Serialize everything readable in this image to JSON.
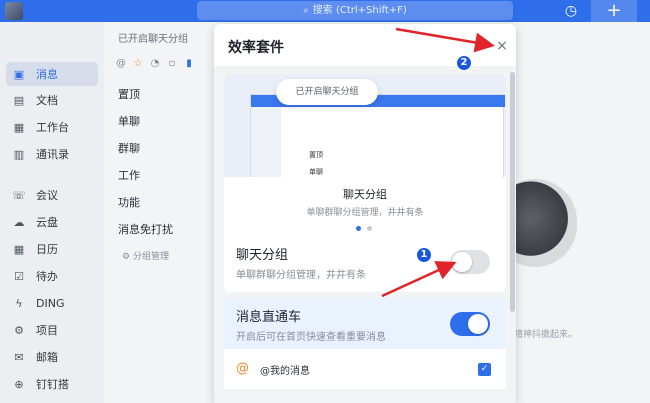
{
  "topbar": {
    "search_placeholder": "搜索 (Ctrl+Shift+F)",
    "search_icon": "search-icon",
    "history_icon": "history-icon",
    "add_label": "+"
  },
  "sidebar": {
    "items": [
      {
        "label": "消息",
        "icon": "message-icon",
        "glyph": "▣",
        "active": true
      },
      {
        "label": "文档",
        "icon": "document-icon",
        "glyph": "▤"
      },
      {
        "label": "工作台",
        "icon": "grid-icon",
        "glyph": "▦"
      },
      {
        "label": "通讯录",
        "icon": "contacts-icon",
        "glyph": "▥"
      },
      {
        "label": "会议",
        "icon": "phone-icon",
        "glyph": "☏"
      },
      {
        "label": "云盘",
        "icon": "cloud-icon",
        "glyph": "☁"
      },
      {
        "label": "日历",
        "icon": "calendar-icon",
        "glyph": "▦"
      },
      {
        "label": "待办",
        "icon": "todo-icon",
        "glyph": "☑"
      },
      {
        "label": "DING",
        "icon": "ding-icon",
        "glyph": "ϟ"
      },
      {
        "label": "项目",
        "icon": "project-icon",
        "glyph": "⚙"
      },
      {
        "label": "邮箱",
        "icon": "mail-icon",
        "glyph": "✉"
      },
      {
        "label": "钉钉搭",
        "icon": "build-icon",
        "glyph": "⊕"
      }
    ]
  },
  "list": {
    "header": "已开启聊天分组",
    "filter_icons": [
      "@",
      "☆",
      "◔",
      "▫",
      "▮"
    ],
    "groups": [
      "置顶",
      "单聊",
      "群聊",
      "工作",
      "功能",
      "消息免打扰"
    ],
    "sub_item": "分组管理"
  },
  "background": {
    "partial_text": "精神抖擞起来。"
  },
  "modal": {
    "title": "效率套件",
    "close_label": "×",
    "preview": {
      "pill_text": "已开启聊天分组",
      "mini_labels": [
        "置顶",
        "单聊"
      ],
      "caption": "聊天分组",
      "subtitle": "单聊群聊分组管理，井井有条",
      "page_count": 2,
      "current_page": 1
    },
    "settings": [
      {
        "title": "聊天分组",
        "subtitle": "单聊群聊分组管理，井井有条",
        "enabled": false
      },
      {
        "title": "消息直通车",
        "subtitle": "开启后可在首页快速查看重要消息",
        "enabled": true
      }
    ],
    "sub_option": {
      "label": "@我的消息",
      "checked": true,
      "icon": "at-icon"
    }
  },
  "annotations": {
    "badge_1": "1",
    "badge_2": "2",
    "arrow_color": "#e0242a"
  },
  "colors": {
    "accent": "#2f6eeb",
    "at_orange": "#f08a24"
  }
}
